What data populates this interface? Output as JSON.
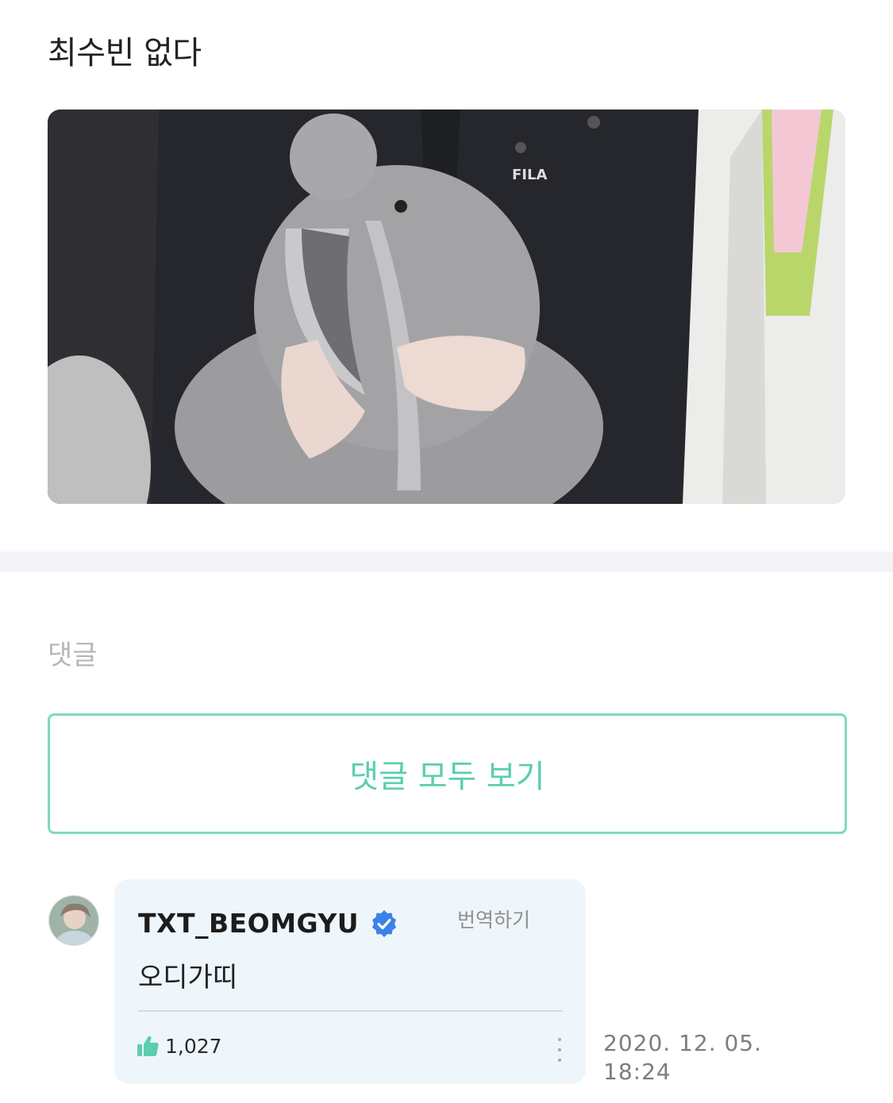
{
  "post": {
    "text": "최수빈 없다"
  },
  "comments": {
    "heading": "댓글",
    "view_all_label": "댓글 모두 보기",
    "items": [
      {
        "author": "TXT_BEOMGYU",
        "verified": true,
        "translate_label": "번역하기",
        "body": "오디가띠",
        "likes": "1,027",
        "date": "2020. 12. 05.",
        "time": "18:24"
      }
    ]
  },
  "colors": {
    "accent": "#5ccdb0",
    "verified_badge": "#3b82e6",
    "bubble": "#eff6fb"
  },
  "icons": [
    "checkmark-badge-icon",
    "thumbs-up-icon",
    "more-vertical-icon"
  ]
}
